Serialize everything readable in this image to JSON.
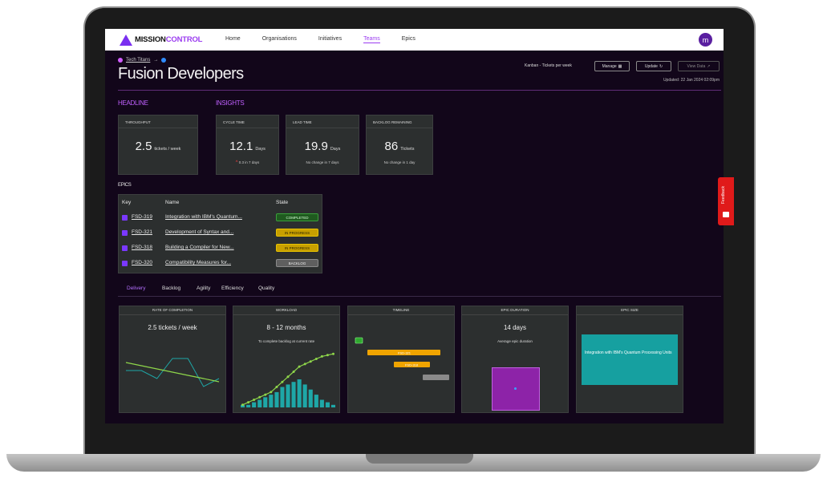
{
  "nav": {
    "logo_part1": "MISSION",
    "logo_part2": "CONTROL",
    "links": [
      "Home",
      "Organisations",
      "Initiatives",
      "Teams",
      "Epics"
    ],
    "active": "Teams",
    "avatar": "m"
  },
  "header": {
    "breadcrumb_team": "Tech Titans",
    "breadcrumb_arrow": "→",
    "title": "Fusion Developers",
    "mode": "Kanban - Tickets per week",
    "manage_label": "Manage",
    "update_label": "Update",
    "view_data_label": "View Data",
    "updated": "Updated: 22 Jan 2024 02:09pm"
  },
  "sections": {
    "headline": "HEADLINE",
    "insights": "INSIGHTS",
    "epics": "EPICS"
  },
  "metrics": [
    {
      "title": "THROUGHPUT",
      "value": "2.5",
      "unit": "tickets / week",
      "sub": ""
    },
    {
      "title": "CYCLE TIME",
      "value": "12.1",
      "unit": "Days",
      "sub": "0.3 in 7 days",
      "trend": "up"
    },
    {
      "title": "LEAD TIME",
      "value": "19.9",
      "unit": "Days",
      "sub": "No change in 7 days"
    },
    {
      "title": "BACKLOG REMAINING",
      "value": "86",
      "unit": "Tickets",
      "sub": "No change in 1 day"
    }
  ],
  "epics_table": {
    "headers": [
      "Key",
      "Name",
      "State"
    ],
    "rows": [
      {
        "key": "FSD-319",
        "name": "Integration with IBM's Quantum...",
        "state": "COMPLETED",
        "state_color": "#2f8a2f"
      },
      {
        "key": "FSD-321",
        "name": "Development of Syntax and...",
        "state": "IN PROGRESS",
        "state_color": "#c8a000"
      },
      {
        "key": "FSD-318",
        "name": "Building a Compiler for New...",
        "state": "IN PROGRESS",
        "state_color": "#c8a000"
      },
      {
        "key": "FSD-320",
        "name": "Compatibility Measures for...",
        "state": "BACKLOG",
        "state_color": "#6a6a6a"
      }
    ]
  },
  "tabs": [
    "Delivery",
    "Backlog",
    "Agility",
    "Efficiency",
    "Quality"
  ],
  "active_tab": "Delivery",
  "panels": {
    "rate": {
      "title": "RATE OF COMPLETION",
      "value": "2.5 tickets / week"
    },
    "workload": {
      "title": "WORKLOAD",
      "value": "8 - 12 months",
      "sub": "To complete backlog at current rate"
    },
    "timeline": {
      "title": "TIMELINE",
      "bar1_label": "FSD-321",
      "bar2_label": "FSD-318"
    },
    "duration": {
      "title": "EPIC DURATION",
      "value": "14 days",
      "sub": "Average epic duration"
    },
    "size": {
      "title": "EPIC SIZE",
      "tile_label": "Integration with IBM's Quantum Processing Units"
    }
  },
  "feedback": "Feedback",
  "colors": {
    "accent": "#9b3cf0",
    "screen_bg": "#12061a",
    "card_bg": "#2c2f2f",
    "feedback": "#e01a1a"
  },
  "chart_data": [
    {
      "type": "line",
      "title": "RATE OF COMPLETION",
      "series": [
        {
          "values": [
            6,
            6,
            4,
            9,
            9,
            2,
            4
          ]
        },
        {
          "values": [
            8,
            7.2,
            6.4,
            5.6,
            4.8,
            4,
            3.2
          ]
        }
      ],
      "ylim": [
        0,
        12
      ]
    },
    {
      "type": "bar",
      "title": "WORKLOAD",
      "values": [
        1,
        1,
        2,
        3,
        4,
        5,
        6,
        8,
        9,
        10,
        11,
        9,
        7,
        5,
        3,
        2,
        1
      ],
      "series": [
        {
          "type": "line",
          "values": [
            1,
            2,
            3,
            4,
            5,
            6,
            8,
            10,
            12,
            14,
            16,
            17,
            18,
            19,
            20,
            20.5,
            21
          ]
        }
      ],
      "ylim": [
        0,
        22
      ]
    },
    {
      "type": "heatmap",
      "title": "EPIC SIZE",
      "categories": [
        "Integration with IBM's Quantum Processing Units"
      ],
      "values": [
        1
      ]
    }
  ]
}
